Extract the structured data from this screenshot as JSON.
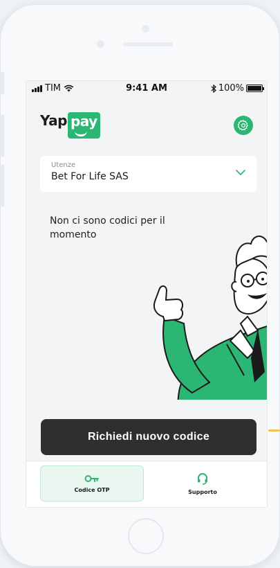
{
  "status_bar": {
    "carrier": "TIM",
    "time": "9:41 AM",
    "battery": "100%"
  },
  "brand": {
    "left": "Yap",
    "right": "pay",
    "accent": "#2bb673"
  },
  "utenze": {
    "label": "Utenze",
    "value": "Bet For Life SAS"
  },
  "empty_message": "Non ci sono codici per il momento",
  "cta_label": "Richiedi nuovo codice",
  "tabs": [
    {
      "label": "Codice OTP",
      "icon": "key-icon",
      "active": true
    },
    {
      "label": "Supporto",
      "icon": "headset-icon",
      "active": false
    }
  ],
  "colors": {
    "primary": "#2bb673",
    "button": "#2f2f2f",
    "tab_active_bg": "#eaf7f1"
  }
}
